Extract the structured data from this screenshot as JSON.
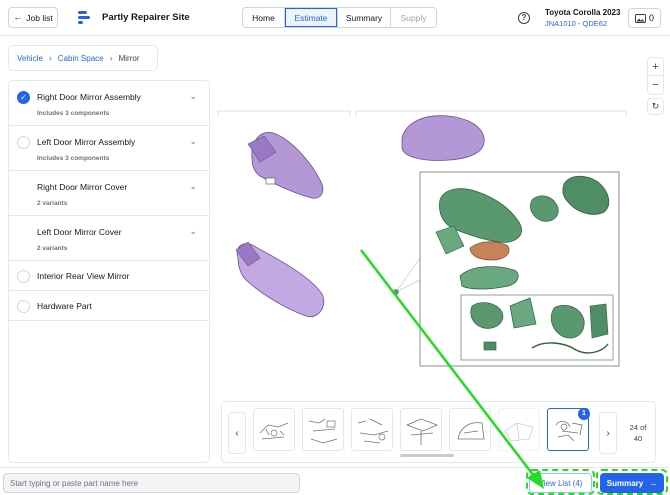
{
  "header": {
    "job_list_label": "Job list",
    "site_name": "Partly Repairer Site",
    "tabs": [
      {
        "label": "Home"
      },
      {
        "label": "Estimate"
      },
      {
        "label": "Summary"
      },
      {
        "label": "Supply"
      }
    ],
    "vehicle_name": "Toyota Corolla 2023",
    "vehicle_code": "JNA1010 - QDE62",
    "image_count": "0",
    "accent_color": "#2563eb"
  },
  "breadcrumb": {
    "items": [
      "Vehicle",
      "Cabin Space"
    ],
    "current": "Mirror"
  },
  "parts": [
    {
      "name": "Right Door Mirror Assembly",
      "sub": "Includes 3 components",
      "checked": true
    },
    {
      "name": "Left Door Mirror Assembly",
      "sub": "Includes 3 components",
      "checked": false
    },
    {
      "name": "Right Door Mirror Cover",
      "sub": "2 variants",
      "checked": false
    },
    {
      "name": "Left Door Mirror Cover",
      "sub": "2 variants",
      "checked": false
    },
    {
      "name": "Interior Rear View Mirror",
      "checked": false
    },
    {
      "name": "Hardware Part",
      "checked": false
    }
  ],
  "thumbnails": {
    "badge": "1",
    "page_current": "24 of",
    "page_total": "40"
  },
  "bottom": {
    "search_placeholder": "Start typing or paste part name here",
    "view_list_label": "View List (4)",
    "summary_label": "Summary"
  }
}
